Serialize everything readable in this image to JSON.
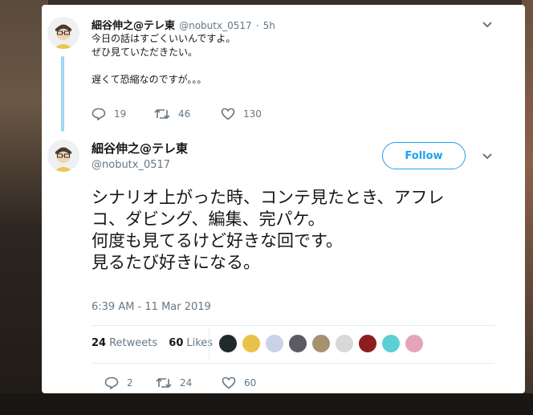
{
  "reply_tweet": {
    "display_name": "細谷伸之@テレ東",
    "handle": "@nobutx_0517",
    "time_ago": "5h",
    "text": "今日の話はすごくいいんですよ。\nぜひ見ていただきたい。\n\n遅くて恐縮なのですが。。。",
    "replies": "19",
    "retweets": "46",
    "likes": "130",
    "icons": {
      "reply": "speech-bubble-icon",
      "retweet": "retweet-arrows-icon",
      "like": "heart-icon",
      "menu": "chevron-down-icon"
    }
  },
  "main_tweet": {
    "display_name": "細谷伸之@テレ東",
    "handle": "@nobutx_0517",
    "follow_label": "Follow",
    "text_lines": [
      "シナリオ上がった時、コンテ見たとき、アフレ",
      "コ、ダビング、編集、完パケ。",
      "何度も見てるけど好きな回です。",
      "見るたび好きになる。"
    ],
    "timestamp": "6:39 AM - 11 Mar 2019",
    "retweets_count": "24",
    "retweets_label": "Retweets",
    "likes_count": "60",
    "likes_label": "Likes",
    "replies": "2",
    "retweets": "24",
    "likes": "60",
    "liker_avatar_colors": [
      "#1f2a2a",
      "#e9c24a",
      "#c9d3e8",
      "#5b5b66",
      "#a89070",
      "#d8d8d8",
      "#8e1e1e",
      "#5ccfd6",
      "#e6a4b8"
    ]
  },
  "colors": {
    "accent": "#1da1f2",
    "thread_line": "#9fd8f2",
    "muted_text": "#657786"
  }
}
